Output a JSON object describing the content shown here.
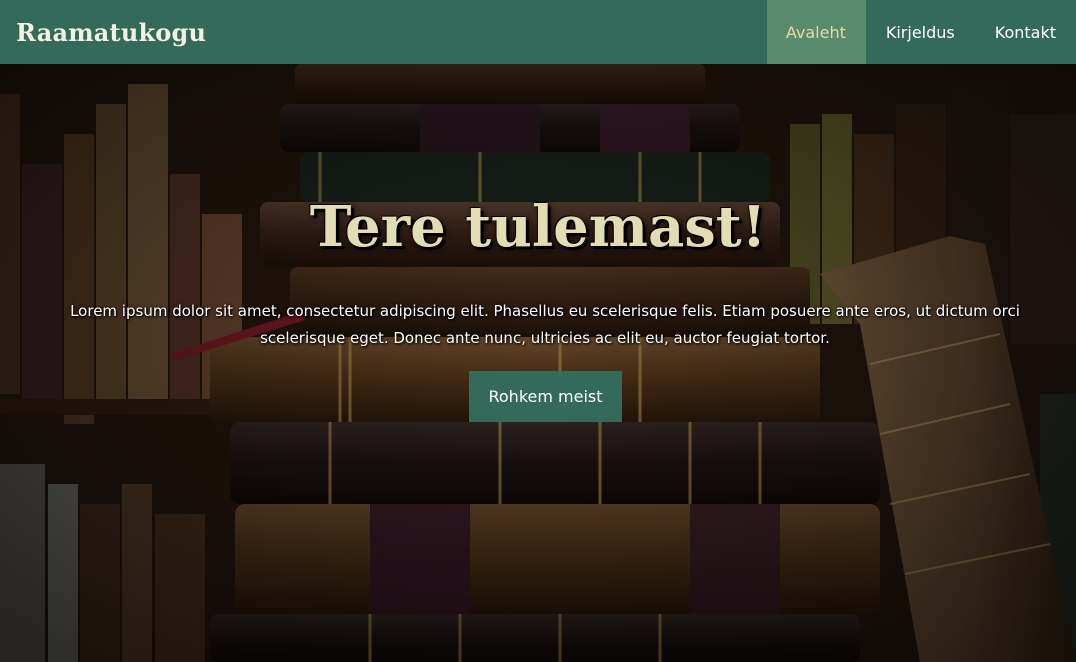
{
  "brand": {
    "name": "Raamatukogu"
  },
  "nav": {
    "items": [
      {
        "label": "Avaleht",
        "active": true
      },
      {
        "label": "Kirjeldus",
        "active": false
      },
      {
        "label": "Kontakt",
        "active": false
      }
    ]
  },
  "hero": {
    "title": "Tere tulemast!",
    "text": "Lorem ipsum dolor sit amet, consectetur adipiscing elit. Phasellus eu scelerisque felis. Etiam posuere ante eros, ut dictum orci scelerisque eget. Donec ante nunc, ultricies ac elit eu, auctor feugiat tortor.",
    "button_label": "Rohkem meist",
    "background": "stack-of-old-books-photo"
  },
  "colors": {
    "navbar": "#336a59",
    "nav_active": "#5a8b6c",
    "nav_active_text": "#e6d9a6",
    "title": "#e3ddb4",
    "button": "#336a59"
  }
}
